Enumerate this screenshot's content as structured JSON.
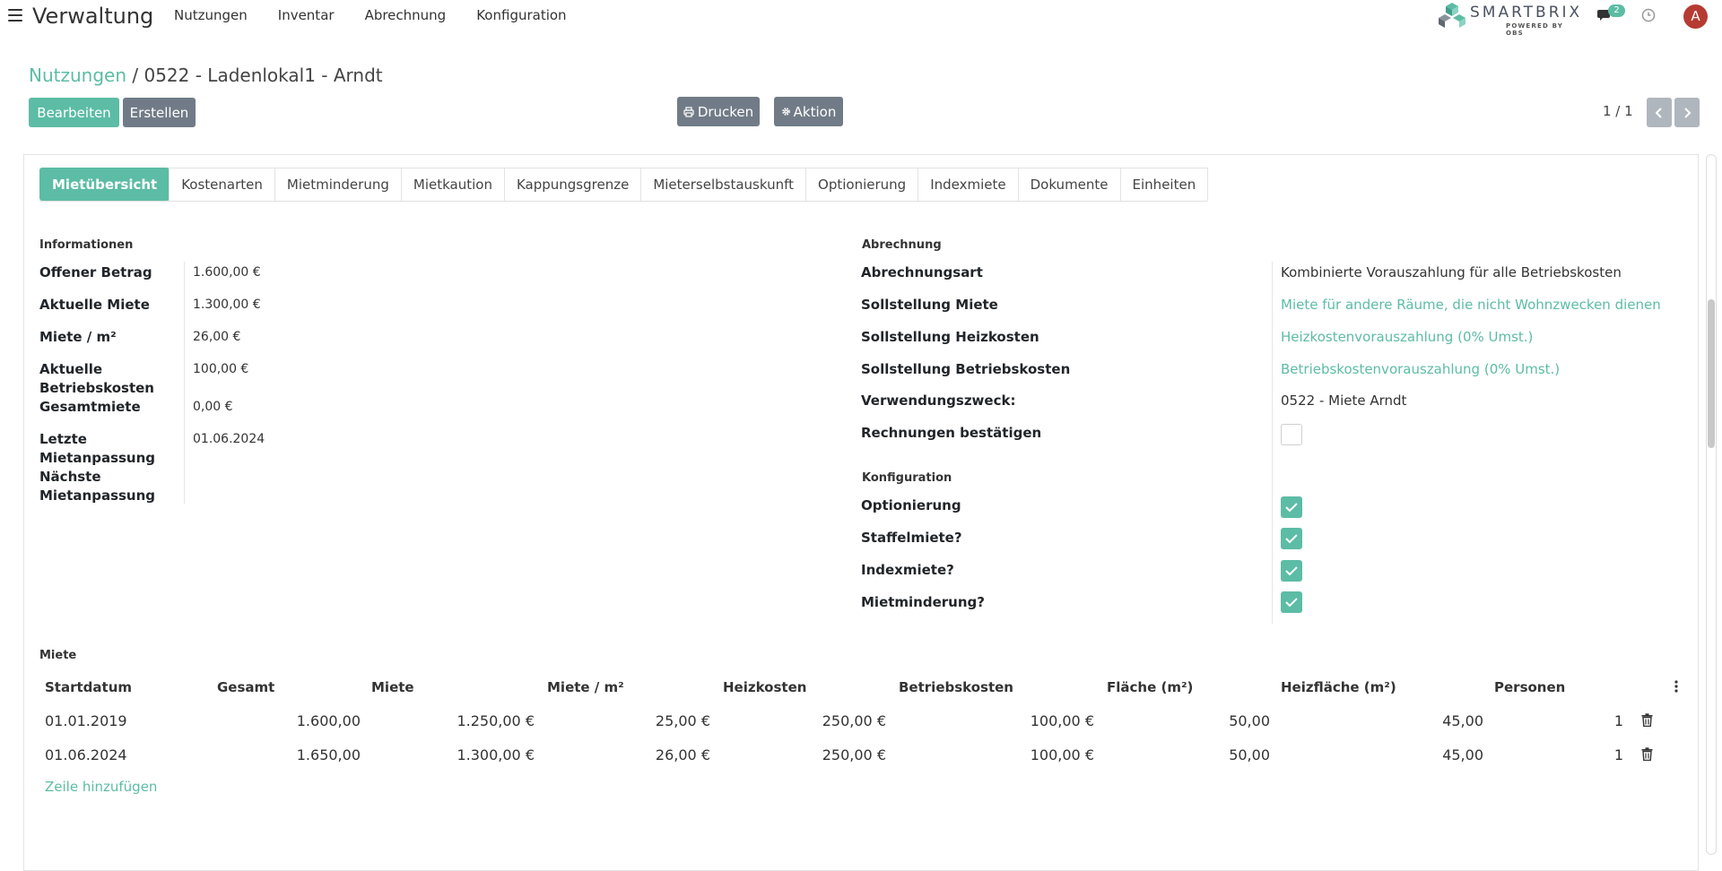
{
  "nav": {
    "app_title": "Verwaltung",
    "menu": [
      "Nutzungen",
      "Inventar",
      "Abrechnung",
      "Konfiguration"
    ],
    "brand_name": "SMARTBRIX",
    "brand_sub": "POWERED BY OBS",
    "chat_count": "2",
    "avatar_letter": "A"
  },
  "breadcrumb": {
    "parent": "Nutzungen",
    "separator": " / ",
    "current": "0522 - Ladenlokal1 - Arndt"
  },
  "buttons": {
    "edit": "Bearbeiten",
    "create": "Erstellen",
    "print": "Drucken",
    "action": "Aktion"
  },
  "pager": {
    "label": "1 / 1"
  },
  "tabs": [
    "Mietübersicht",
    "Kostenarten",
    "Mietminderung",
    "Mietkaution",
    "Kappungsgrenze",
    "Mieterselbstauskunft",
    "Optionierung",
    "Indexmiete",
    "Dokumente",
    "Einheiten"
  ],
  "info": {
    "title": "Informationen",
    "offener_betrag": {
      "label": "Offener Betrag",
      "value": "1.600,00 €"
    },
    "aktuelle_miete": {
      "label": "Aktuelle Miete",
      "value": "1.300,00 €"
    },
    "miete_m2": {
      "label": "Miete / m²",
      "value": "26,00 €"
    },
    "betriebskosten": {
      "label_1": "Aktuelle",
      "label_2": "Betriebskosten",
      "value": "100,00 €"
    },
    "gesamtmiete": {
      "label": "Gesamtmiete",
      "value": "0,00 €"
    },
    "letzte": {
      "label_1": "Letzte",
      "label_2": "Mietanpassung",
      "value": "01.06.2024"
    },
    "naechste": {
      "label_1": "Nächste",
      "label_2": "Mietanpassung"
    }
  },
  "abrechnung": {
    "title": "Abrechnung",
    "art": {
      "label": "Abrechnungsart",
      "value": "Kombinierte Vorauszahlung für alle Betriebskosten"
    },
    "soll_miete": {
      "label": "Sollstellung Miete",
      "value": "Miete für andere Räume, die nicht Wohnzwecken dienen"
    },
    "soll_heiz": {
      "label": "Sollstellung Heizkosten",
      "value": "Heizkostenvorauszahlung (0% Umst.)"
    },
    "soll_betrieb": {
      "label": "Sollstellung Betriebskosten",
      "value": "Betriebskostenvorauszahlung (0% Umst.)"
    },
    "zweck": {
      "label": "Verwendungszweck:",
      "value": "0522 - Miete Arndt"
    },
    "rechnungen": {
      "label": "Rechnungen bestätigen",
      "checked": false
    }
  },
  "konfiguration": {
    "title": "Konfiguration",
    "items": [
      {
        "label": "Optionierung",
        "checked": true
      },
      {
        "label": "Staffelmiete?",
        "checked": true
      },
      {
        "label": "Indexmiete?",
        "checked": true
      },
      {
        "label": "Mietminderung?",
        "checked": true
      }
    ]
  },
  "miete": {
    "title": "Miete",
    "columns": [
      "Startdatum",
      "Gesamt",
      "Miete",
      "Miete / m²",
      "Heizkosten",
      "Betriebskosten",
      "Fläche (m²)",
      "Heizfläche (m²)",
      "Personen"
    ],
    "rows": [
      [
        "01.01.2019",
        "1.600,00",
        "1.250,00 €",
        "25,00 €",
        "250,00 €",
        "100,00 €",
        "50,00",
        "45,00",
        "1"
      ],
      [
        "01.06.2024",
        "1.650,00",
        "1.300,00 €",
        "26,00 €",
        "250,00 €",
        "100,00 €",
        "50,00",
        "45,00",
        "1"
      ]
    ],
    "add_line": "Zeile hinzufügen"
  },
  "colors": {
    "accent": "#5cbca5",
    "secondary_button": "#717b87",
    "avatar": "#b63b32"
  }
}
